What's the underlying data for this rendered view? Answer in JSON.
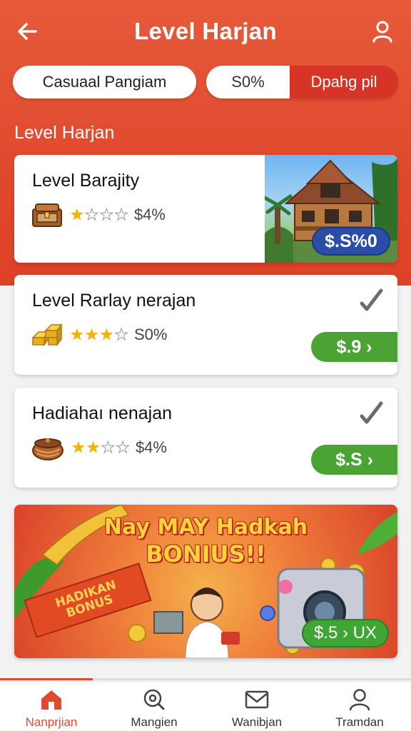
{
  "header": {
    "title": "Level Harjan",
    "back_icon": "arrow-left-icon",
    "profile_icon": "user-icon"
  },
  "filters": {
    "casual_label": "Casuaal Pangiam",
    "percent_label": "S0%",
    "dpahg_label": "Dpahg pil"
  },
  "section": {
    "title": "Level Harjan"
  },
  "levels": [
    {
      "title": "Level Barajity",
      "stars_filled": 1,
      "stars_total": 4,
      "percent": "$4%",
      "badge": "$.S%0",
      "badge_color": "#2a4ea8",
      "icon": "treasure-chest-icon",
      "image": "house-image"
    },
    {
      "title": "Level Rarlay nerajan",
      "stars_filled": 3,
      "stars_total": 4,
      "percent": "S0%",
      "badge": "$.9 ›",
      "badge_color": "#4aa332",
      "icon": "gold-bars-icon",
      "check_icon": "check-icon"
    },
    {
      "title": "Hadiahaı nenajan",
      "stars_filled": 2,
      "stars_total": 4,
      "percent": "$4%",
      "badge": "$.S ›",
      "badge_color": "#4aa332",
      "icon": "treasure-pot-icon",
      "check_icon": "check-icon"
    }
  ],
  "banner": {
    "headline_line1": "Nay MAY Hadkah",
    "headline_line2": "BONIUS!!",
    "ribbon_line1": "HADIKAN",
    "ribbon_line2": "BONUS",
    "button_label": "$.5 › UX"
  },
  "nav": [
    {
      "label": "Nanprjian",
      "icon": "home-icon",
      "active": true
    },
    {
      "label": "Mangien",
      "icon": "search-icon",
      "active": false
    },
    {
      "label": "Wanibjan",
      "icon": "mail-icon",
      "active": false
    },
    {
      "label": "Tramdan",
      "icon": "user-icon",
      "active": false
    }
  ],
  "colors": {
    "accent": "#e14a2e",
    "green": "#4aa332",
    "blue": "#2a4ea8",
    "star": "#f4b400"
  }
}
